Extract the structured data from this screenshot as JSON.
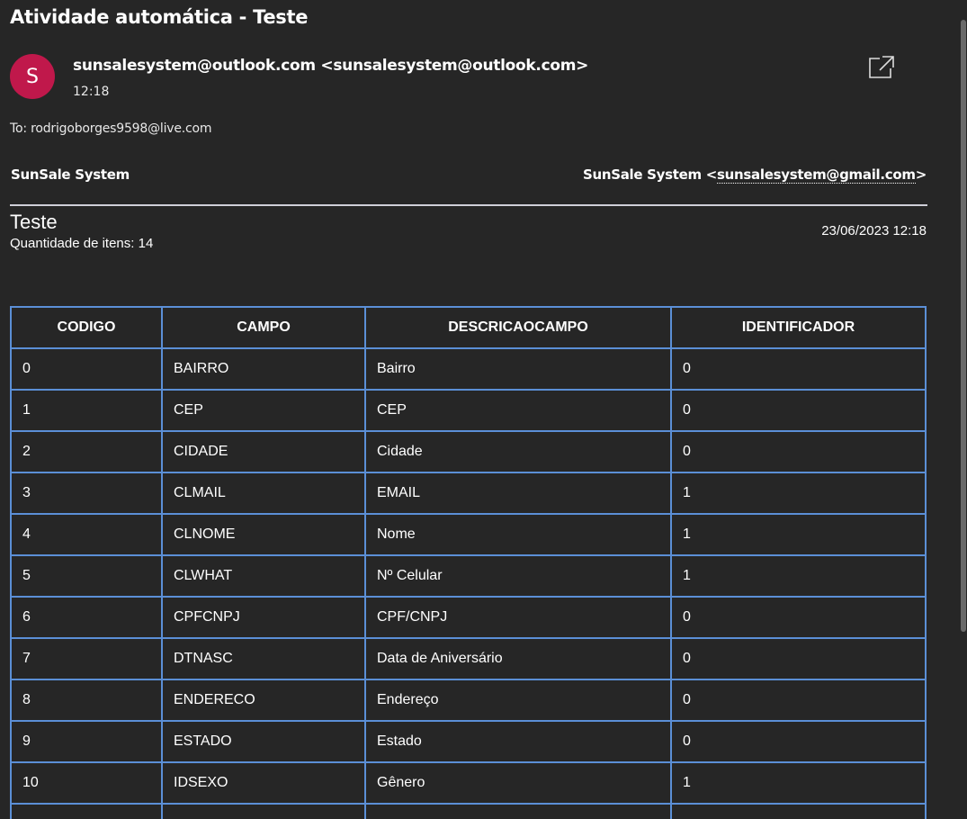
{
  "email": {
    "subject": "Atividade automática - Teste",
    "avatar_letter": "S",
    "sender": "sunsalesystem@outlook.com <sunsalesystem@outlook.com>",
    "time": "12:18",
    "to": "To: rodrigoborges9598@live.com"
  },
  "brand": {
    "left": "SunSale System",
    "right_prefix": "SunSale System <",
    "right_link": "sunsalesystem@gmail.com",
    "right_suffix": ">"
  },
  "report": {
    "title": "Teste",
    "count": "Quantidade de itens: 14",
    "date": "23/06/2023 12:18"
  },
  "table": {
    "headers": [
      "CODIGO",
      "CAMPO",
      "DESCRICAOCAMPO",
      "IDENTIFICADOR"
    ],
    "rows": [
      [
        "0",
        "BAIRRO",
        "Bairro",
        "0"
      ],
      [
        "1",
        "CEP",
        "CEP",
        "0"
      ],
      [
        "2",
        "CIDADE",
        "Cidade",
        "0"
      ],
      [
        "3",
        "CLMAIL",
        "EMAIL",
        "1"
      ],
      [
        "4",
        "CLNOME",
        "Nome",
        "1"
      ],
      [
        "5",
        "CLWHAT",
        "Nº Celular",
        "1"
      ],
      [
        "6",
        "CPFCNPJ",
        "CPF/CNPJ",
        "0"
      ],
      [
        "7",
        "DTNASC",
        "Data de Aniversário",
        "0"
      ],
      [
        "8",
        "ENDERECO",
        "Endereço",
        "0"
      ],
      [
        "9",
        "ESTADO",
        "Estado",
        "0"
      ],
      [
        "10",
        "IDSEXO",
        "Gênero",
        "1"
      ]
    ]
  },
  "icons": {
    "popout": "open-in-new-window-icon"
  },
  "colors": {
    "background": "#262626",
    "avatar": "#c0184b",
    "table_border": "#5b8fd6",
    "rule": "#cfcfd8"
  }
}
